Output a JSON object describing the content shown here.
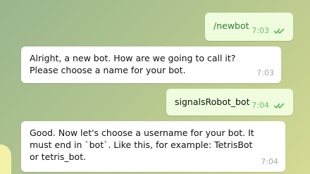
{
  "messages": [
    {
      "dir": "out",
      "text": "/newbot",
      "time": "7:03"
    },
    {
      "dir": "in",
      "text": "Alright, a new bot. How are we going to call it?\nPlease choose a name for your bot.",
      "time": "7:03"
    },
    {
      "dir": "out",
      "text": "signalsRobot_bot",
      "time": "7:04"
    },
    {
      "dir": "in",
      "text": "Good. Now let's choose a username for your bot. It\nmust end in `bot`. Like this, for example: TetrisBot\nor tetris_bot.",
      "time": "7:04"
    }
  ],
  "icons": {
    "read_receipt": "double-check-icon"
  },
  "colors": {
    "outgoing_bubble": "#effdde",
    "incoming_bubble": "#ffffff",
    "tick": "#5cb85c"
  }
}
